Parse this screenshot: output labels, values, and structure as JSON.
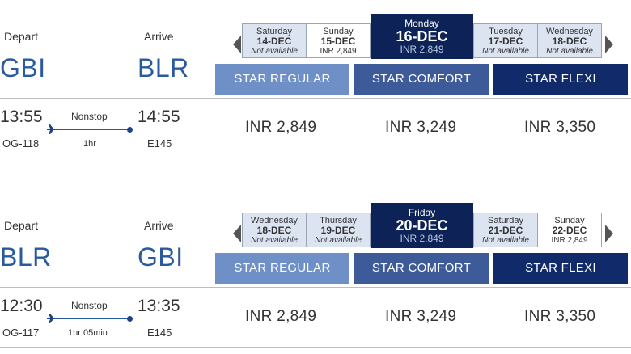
{
  "journeys": [
    {
      "depart_label": "Depart",
      "arrive_label": "Arrive",
      "from": "GBI",
      "to": "BLR",
      "dates": [
        {
          "day": "Saturday",
          "date": "14-DEC",
          "price": "Not available"
        },
        {
          "day": "Sunday",
          "date": "15-DEC",
          "price": "INR 2,849"
        },
        {
          "day": "Monday",
          "date": "16-DEC",
          "price": "INR 2,849"
        },
        {
          "day": "Tuesday",
          "date": "17-DEC",
          "price": "Not available"
        },
        {
          "day": "Wednesday",
          "date": "18-DEC",
          "price": "Not available"
        }
      ],
      "fare_tabs": [
        "STAR REGULAR",
        "STAR COMFORT",
        "STAR FLEXI"
      ],
      "flight": {
        "dep_time": "13:55",
        "arr_time": "14:55",
        "flight_no": "OG-118",
        "aircraft": "E145",
        "stops": "Nonstop",
        "duration": "1hr",
        "fares": [
          "INR 2,849",
          "INR 3,249",
          "INR 3,350"
        ]
      }
    },
    {
      "depart_label": "Depart",
      "arrive_label": "Arrive",
      "from": "BLR",
      "to": "GBI",
      "dates": [
        {
          "day": "Wednesday",
          "date": "18-DEC",
          "price": "Not available"
        },
        {
          "day": "Thursday",
          "date": "19-DEC",
          "price": "Not available"
        },
        {
          "day": "Friday",
          "date": "20-DEC",
          "price": "INR 2,849"
        },
        {
          "day": "Saturday",
          "date": "21-DEC",
          "price": "Not available"
        },
        {
          "day": "Sunday",
          "date": "22-DEC",
          "price": "INR 2,849"
        }
      ],
      "fare_tabs": [
        "STAR REGULAR",
        "STAR COMFORT",
        "STAR FLEXI"
      ],
      "flight": {
        "dep_time": "12:30",
        "arr_time": "13:35",
        "flight_no": "OG-117",
        "aircraft": "E145",
        "stops": "Nonstop",
        "duration": "1hr 05min",
        "fares": [
          "INR 2,849",
          "INR 3,249",
          "INR 3,350"
        ]
      }
    }
  ],
  "icons": {
    "prev": "caret-left-icon",
    "next": "caret-right-icon",
    "plane": "plane-icon",
    "destination": "dot-icon"
  },
  "colors": {
    "city": "#2a5a9e",
    "selected_date_bg": "#0d2357",
    "unavailable_date_bg": "#dce4f1",
    "star_regular": "#6f8fc7",
    "star_comfort": "#3d5a99",
    "star_flexi": "#102a6a"
  }
}
